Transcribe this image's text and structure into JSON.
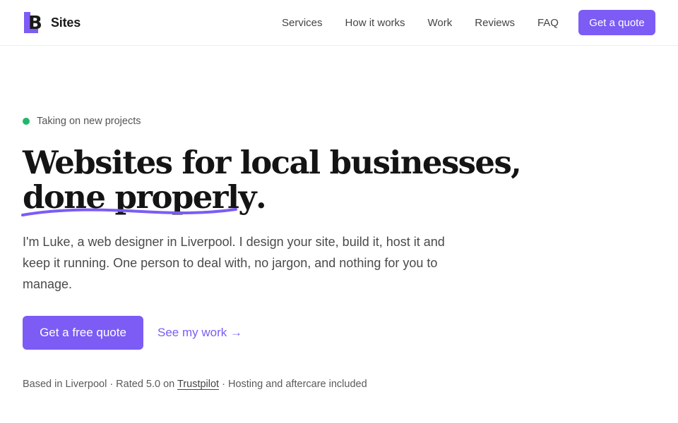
{
  "brand": {
    "logo_letter": "B",
    "name": "Sites",
    "accent_color": "#7c5cf5",
    "logo_color": "#5b3fd6"
  },
  "nav": {
    "items": [
      {
        "label": "Services"
      },
      {
        "label": "How it works"
      },
      {
        "label": "Work"
      },
      {
        "label": "Reviews"
      },
      {
        "label": "FAQ"
      }
    ],
    "cta_label": "Get a quote"
  },
  "hero": {
    "badge_text": "Taking on new projects",
    "badge_color": "#1fb86b",
    "headline_line1": "Websites for local businesses,",
    "headline_line2_underlined": "done properly",
    "headline_line2_end": ".",
    "lead": "I'm Luke, a web designer in Liverpool. I design your site, build it, host it and keep it running. One person to deal with, no jargon, and nothing for you to manage.",
    "primary_cta": "Get a free quote",
    "secondary_cta": "See my work →"
  },
  "meta": {
    "prefix": "Based in Liverpool · Rated 5.0 on ",
    "trustpilot": "Trustpilot",
    "suffix": " · Hosting and aftercare included"
  }
}
